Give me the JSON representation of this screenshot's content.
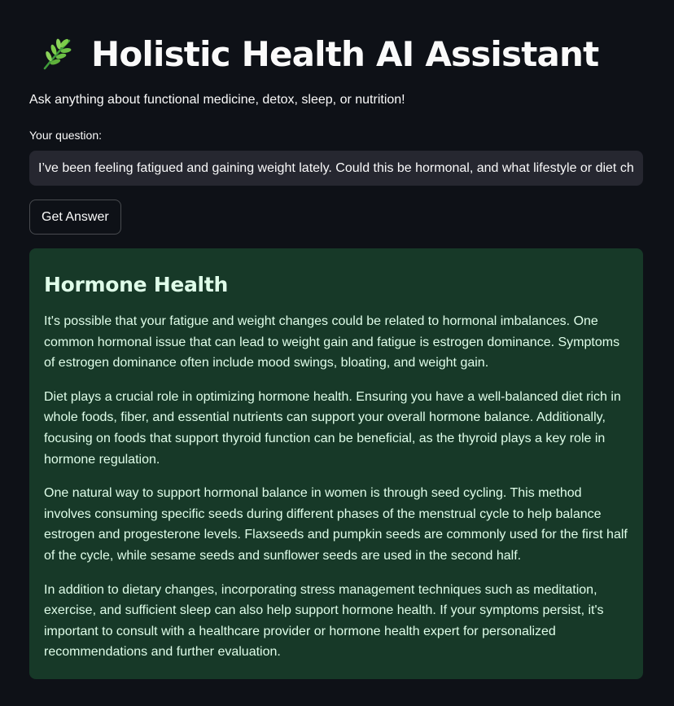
{
  "header": {
    "icon": "leaf-icon",
    "title": "Holistic Health AI Assistant",
    "subtitle": "Ask anything about functional medicine, detox, sleep, or nutrition!"
  },
  "question": {
    "label": "Your question:",
    "value": "I’ve been feeling fatigued and gaining weight lately. Could this be hormonal, and what lifestyle or diet changes can help?"
  },
  "actions": {
    "get_answer_label": "Get Answer"
  },
  "answer": {
    "heading": "Hormone Health",
    "paragraphs": [
      "It's possible that your fatigue and weight changes could be related to hormonal imbalances. One common hormonal issue that can lead to weight gain and fatigue is estrogen dominance. Symptoms of estrogen dominance often include mood swings, bloating, and weight gain.",
      "Diet plays a crucial role in optimizing hormone health. Ensuring you have a well-balanced diet rich in whole foods, fiber, and essential nutrients can support your overall hormone balance. Additionally, focusing on foods that support thyroid function can be beneficial, as the thyroid plays a key role in hormone regulation.",
      "One natural way to support hormonal balance in women is through seed cycling. This method involves consuming specific seeds during different phases of the menstrual cycle to help balance estrogen and progesterone levels. Flaxseeds and pumpkin seeds are commonly used for the first half of the cycle, while sesame seeds and sunflower seeds are used in the second half.",
      "In addition to dietary changes, incorporating stress management techniques such as meditation, exercise, and sufficient sleep can also help support hormone health. If your symptoms persist, it's important to consult with a healthcare provider or hormone health expert for personalized recommendations and further evaluation."
    ]
  },
  "colors": {
    "background": "#0e1117",
    "input_background": "#262730",
    "success_background": "#173928",
    "success_text": "#dffde9",
    "leaf_green": "#4caf50"
  }
}
